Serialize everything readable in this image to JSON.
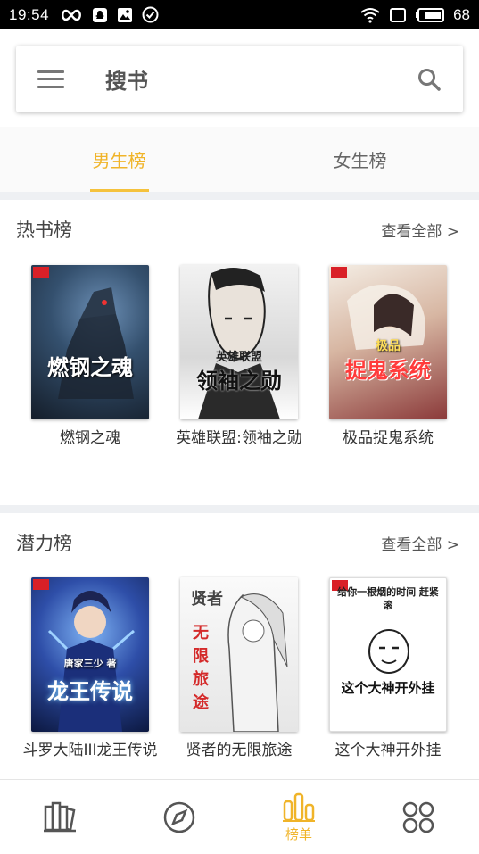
{
  "status_bar": {
    "time": "19:54",
    "battery": "68",
    "icons": [
      "infinity-icon",
      "snapchat-icon",
      "image-icon",
      "check-circle-icon",
      "wifi-icon",
      "screen-icon",
      "battery-icon"
    ]
  },
  "search_bar": {
    "title": "搜书",
    "menu_icon": "menu-icon",
    "search_icon": "search-icon"
  },
  "tabs": [
    {
      "label": "男生榜",
      "active": true
    },
    {
      "label": "女生榜",
      "active": false
    }
  ],
  "sections": [
    {
      "title": "热书榜",
      "view_all": "查看全部 >",
      "books": [
        {
          "title": "燃钢之魂",
          "cover_text": "燃钢之魂"
        },
        {
          "title": "英雄联盟:领袖之勋",
          "cover_text": "领袖之勋",
          "cover_sub": "英雄联盟"
        },
        {
          "title": "极品捉鬼系统",
          "cover_text": "捉鬼系统",
          "cover_sub": "极品"
        }
      ]
    },
    {
      "title": "潜力榜",
      "view_all": "查看全部 >",
      "books": [
        {
          "title": "斗罗大陆III龙王传说",
          "cover_text": "龙王传说",
          "cover_sub": "唐家三少 著"
        },
        {
          "title": "贤者的无限旅途",
          "cover_text": "无限旅途",
          "cover_sub": "贤者"
        },
        {
          "title": "这个大神开外挂",
          "cover_text": "这个大神开外挂",
          "cover_sub": "给你一根烟的时间 赶紧滚"
        }
      ]
    }
  ],
  "bottom_nav": [
    {
      "icon": "bookshelf-icon",
      "label": ""
    },
    {
      "icon": "compass-icon",
      "label": ""
    },
    {
      "icon": "ranking-icon",
      "label": "榜单",
      "active": true
    },
    {
      "icon": "grid-icon",
      "label": ""
    }
  ],
  "colors": {
    "accent": "#f0b429",
    "separator": "#eef0f3"
  }
}
